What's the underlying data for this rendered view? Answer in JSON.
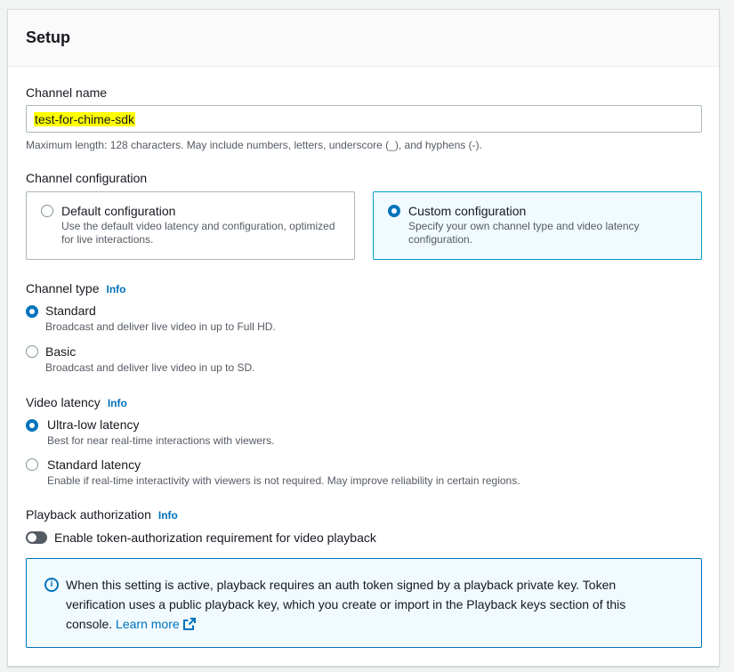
{
  "panel": {
    "title": "Setup"
  },
  "channel_name": {
    "label": "Channel name",
    "value": "test-for-chime-sdk",
    "hint": "Maximum length: 128 characters. May include numbers, letters, underscore (_), and hyphens (-)."
  },
  "channel_configuration": {
    "label": "Channel configuration",
    "options": [
      {
        "title": "Default configuration",
        "description": "Use the default video latency and configuration, optimized for live interactions.",
        "selected": false
      },
      {
        "title": "Custom configuration",
        "description": "Specify your own channel type and video latency configuration.",
        "selected": true
      }
    ]
  },
  "channel_type": {
    "label": "Channel type",
    "info": "Info",
    "options": [
      {
        "title": "Standard",
        "description": "Broadcast and deliver live video in up to Full HD.",
        "selected": true
      },
      {
        "title": "Basic",
        "description": "Broadcast and deliver live video in up to SD.",
        "selected": false
      }
    ]
  },
  "video_latency": {
    "label": "Video latency",
    "info": "Info",
    "options": [
      {
        "title": "Ultra-low latency",
        "description": "Best for near real-time interactions with viewers.",
        "selected": true
      },
      {
        "title": "Standard latency",
        "description": "Enable if real-time interactivity with viewers is not required. May improve reliability in certain regions.",
        "selected": false
      }
    ]
  },
  "playback_authorization": {
    "label": "Playback authorization",
    "info": "Info",
    "toggle_label": "Enable token-authorization requirement for video playback",
    "enabled": false
  },
  "alert": {
    "text": "When this setting is active, playback requires an auth token signed by a playback private key. Token verification uses a public playback key, which you create or import in the Playback keys section of this console.",
    "link": "Learn more",
    "icon": "info-icon"
  },
  "colors": {
    "accent": "#0073bb",
    "selected_border": "#00a1c9",
    "selected_bg": "#f1faff",
    "highlight": "#ffff00"
  }
}
